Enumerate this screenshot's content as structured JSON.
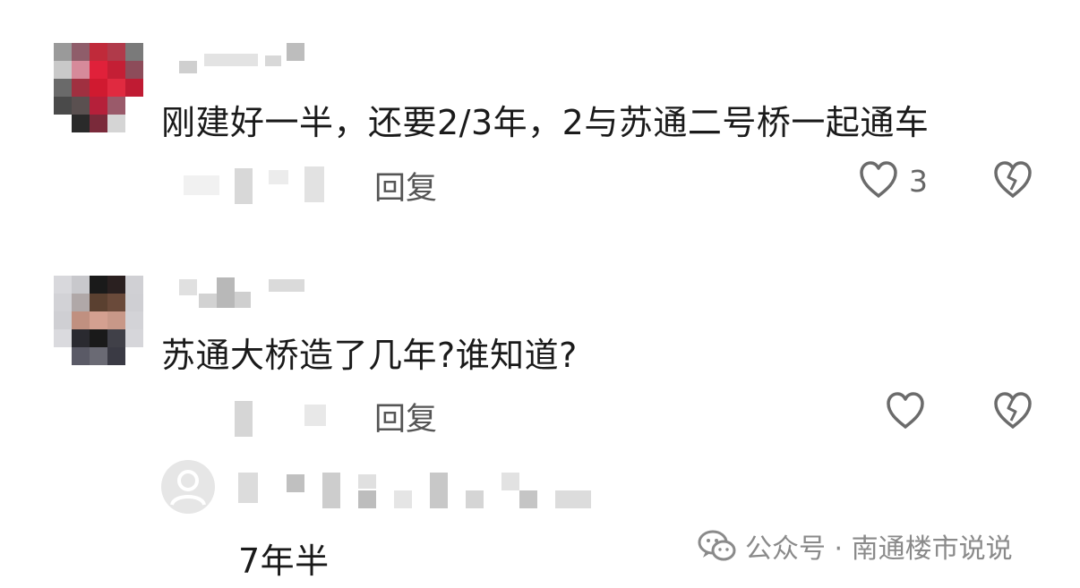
{
  "comments": [
    {
      "text": "刚建好一半，还要2/3年，2与苏通二号桥一起通车",
      "reply_label": "回复",
      "like_count": "3"
    },
    {
      "text": "苏通大桥造了几年?谁知道?",
      "reply_label": "回复",
      "like_count": "",
      "replies": [
        {
          "text": "7年半"
        }
      ]
    }
  ],
  "watermark": {
    "label": "公众号 · 南通楼市说说"
  },
  "icons": [
    "heart-outline-icon",
    "broken-heart-icon",
    "default-avatar-icon",
    "wechat-icon"
  ],
  "colors": {
    "icon_gray": "#6b6b6b",
    "text": "#1a1a1a",
    "muted": "#555555"
  }
}
